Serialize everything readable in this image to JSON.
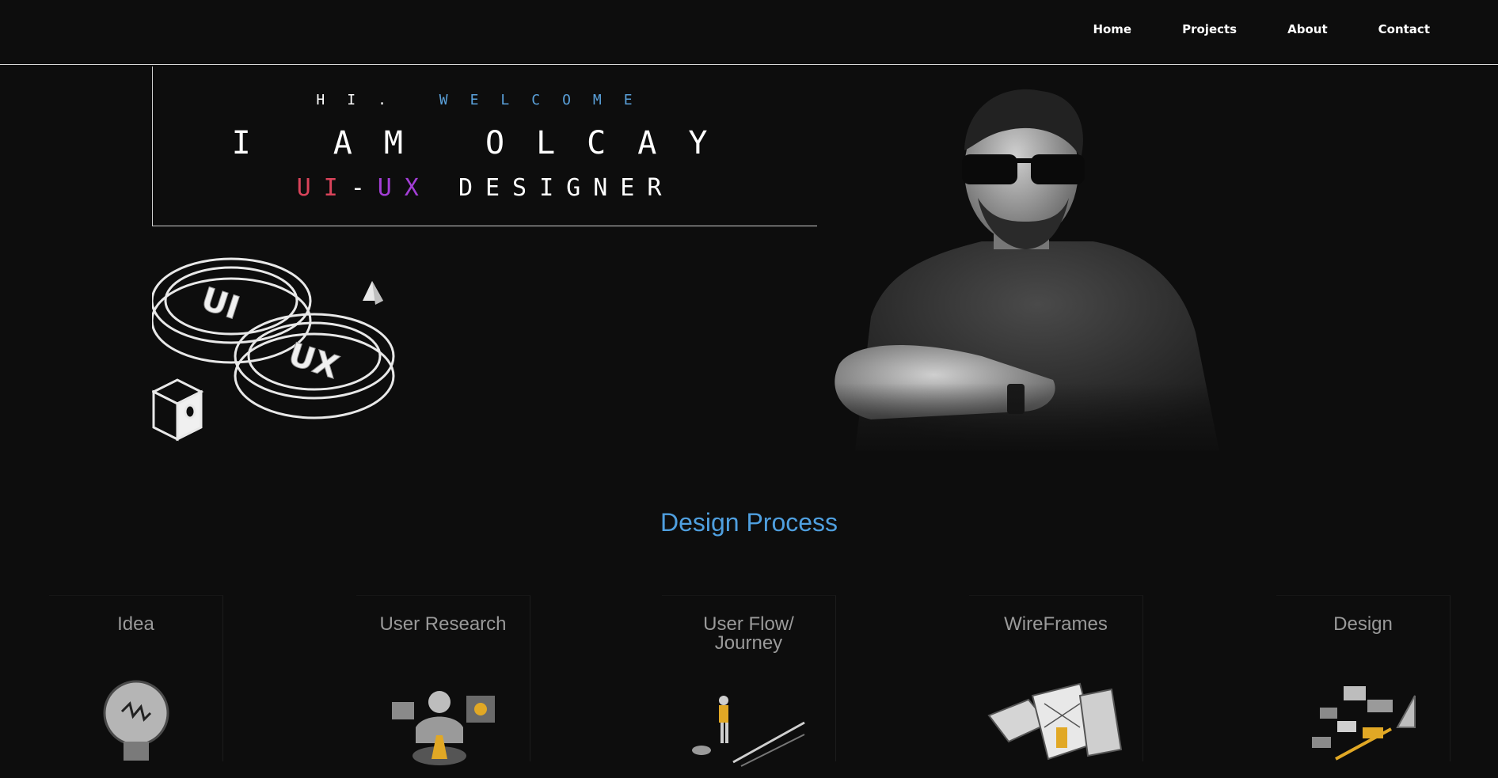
{
  "nav": {
    "items": [
      "Home",
      "Projects",
      "About",
      "Contact"
    ]
  },
  "hero": {
    "welcome_hi": "HI.",
    "welcome_word": "WELCOME",
    "name": "I AM OLCAY",
    "role_ui": "UI",
    "role_dash": "-",
    "role_ux": "UX",
    "role_rest": "DESIGNER",
    "graphic_label_ui": "UI",
    "graphic_label_ux": "UX"
  },
  "process": {
    "title": "Design Process",
    "steps": [
      {
        "label": "Idea",
        "icon": "lightbulb-icon"
      },
      {
        "label": "User Research",
        "icon": "user-research-icon"
      },
      {
        "label": "User Flow/\nJourney",
        "icon": "user-flow-icon"
      },
      {
        "label": "WireFrames",
        "icon": "wireframes-icon"
      },
      {
        "label": "Design",
        "icon": "design-icon"
      }
    ]
  },
  "colors": {
    "background": "#0d0d0d",
    "accent_blue": "#4f9fdf",
    "ui_red": "#d9435a",
    "ux_purple": "#a33ed6"
  }
}
